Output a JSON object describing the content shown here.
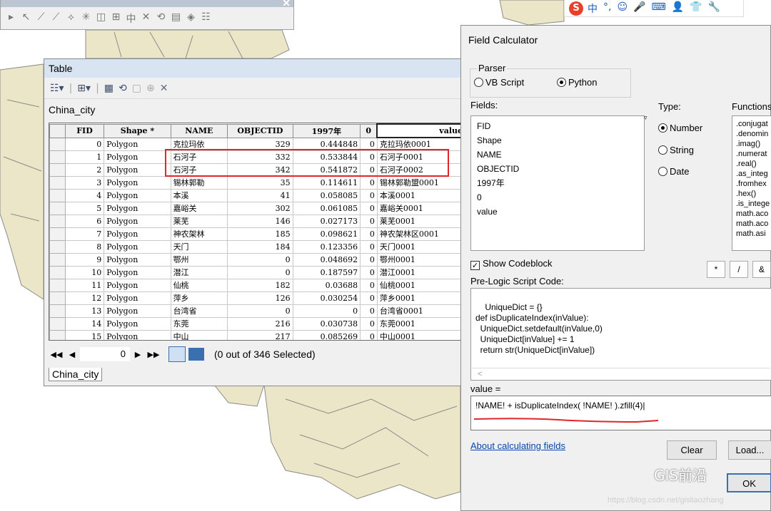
{
  "toolbar": {
    "close": "✕",
    "icons": [
      "▸",
      "↖",
      "⟋",
      "⟋",
      "⟡",
      "✳",
      "◫",
      "⊞",
      "中",
      "✕",
      "⟲",
      "▤",
      "◈",
      "☷"
    ]
  },
  "ime": {
    "logo": "S",
    "icons": [
      "中",
      "°,",
      "☺",
      "🎤",
      "⌨",
      "👤",
      "👕",
      "🔧"
    ]
  },
  "table_window": {
    "title": "Table",
    "layer_name": "China_city",
    "columns": [
      "",
      "FID",
      "Shape *",
      "NAME",
      "OBJECTID",
      "1997年",
      "0",
      "value"
    ],
    "rows": [
      [
        "0",
        "Polygon",
        "克拉玛依",
        "329",
        "0.444848",
        "0",
        "克拉玛依0001"
      ],
      [
        "1",
        "Polygon",
        "石河子",
        "332",
        "0.533844",
        "0",
        "石河子0001"
      ],
      [
        "2",
        "Polygon",
        "石河子",
        "342",
        "0.541872",
        "0",
        "石河子0002"
      ],
      [
        "3",
        "Polygon",
        "锡林郭勒",
        "35",
        "0.114611",
        "0",
        "锡林郭勒盟0001"
      ],
      [
        "4",
        "Polygon",
        "本溪",
        "41",
        "0.058085",
        "0",
        "本溪0001"
      ],
      [
        "5",
        "Polygon",
        "嘉峪关",
        "302",
        "0.061085",
        "0",
        "嘉峪关0001"
      ],
      [
        "6",
        "Polygon",
        "莱芜",
        "146",
        "0.027173",
        "0",
        "莱芜0001"
      ],
      [
        "7",
        "Polygon",
        "神农架林",
        "185",
        "0.098621",
        "0",
        "神农架林区0001"
      ],
      [
        "8",
        "Polygon",
        "天门",
        "184",
        "0.123356",
        "0",
        "天门0001"
      ],
      [
        "9",
        "Polygon",
        "鄂州",
        "0",
        "0.048692",
        "0",
        "鄂州0001"
      ],
      [
        "10",
        "Polygon",
        "潜江",
        "0",
        "0.187597",
        "0",
        "潜江0001"
      ],
      [
        "11",
        "Polygon",
        "仙桃",
        "182",
        "0.03688",
        "0",
        "仙桃0001"
      ],
      [
        "12",
        "Polygon",
        "萍乡",
        "126",
        "0.030254",
        "0",
        "萍乡0001"
      ],
      [
        "13",
        "Polygon",
        "台湾省",
        "0",
        "0",
        "0",
        "台湾省0001"
      ],
      [
        "14",
        "Polygon",
        "东莞",
        "216",
        "0.030738",
        "0",
        "东莞0001"
      ],
      [
        "15",
        "Polygon",
        "中山",
        "217",
        "0.085269",
        "0",
        "中山0001"
      ]
    ],
    "nav": {
      "first": "◀◀",
      "prev": "◀",
      "record": "0",
      "next": "▶",
      "last": "▶▶",
      "status": "(0 out of 346 Selected)"
    },
    "tab": "China_city"
  },
  "field_calculator": {
    "title": "Field Calculator",
    "parser_label": "Parser",
    "parser_options": [
      "VB Script",
      "Python"
    ],
    "fields_label": "Fields:",
    "fields": [
      "FID",
      "Shape",
      "NAME",
      "OBJECTID",
      "1997年",
      "0",
      "value"
    ],
    "type_label": "Type:",
    "types": [
      "Number",
      "String",
      "Date"
    ],
    "functions_label": "Functions",
    "functions": [
      ".conjugat",
      ".denomin",
      ".imag()",
      ".numerat",
      ".real()",
      ".as_integ",
      ".fromhex",
      ".hex()",
      ".is_intege",
      "math.aco",
      "math.aco",
      "math.asi"
    ],
    "show_codeblock": "Show Codeblock",
    "operators": [
      "*",
      "/",
      "&"
    ],
    "prelogic_label": "Pre-Logic Script Code:",
    "prelogic_code": "UniqueDict = {}\ndef isDuplicateIndex(inValue):\n  UniqueDict.setdefault(inValue,0)\n  UniqueDict[inValue] += 1\n  return str(UniqueDict[inValue])",
    "expr_label": "value =",
    "expression": "!NAME! + isDuplicateIndex( !NAME! ).zfill(4)",
    "about_link": "About calculating fields",
    "clear_button": "Clear",
    "load_button": "Load...",
    "ok_button": "OK",
    "scroll_left": "<"
  },
  "watermark": {
    "text": "GIS前沿",
    "url": "https://blog.csdn.net/gisliaozhang"
  },
  "colors": {
    "map_fill": "#ece6c8",
    "map_line": "#8a8a8a",
    "highlight": "#e0262a",
    "title_bar": "#d8e4f2",
    "link": "#0645ad"
  }
}
